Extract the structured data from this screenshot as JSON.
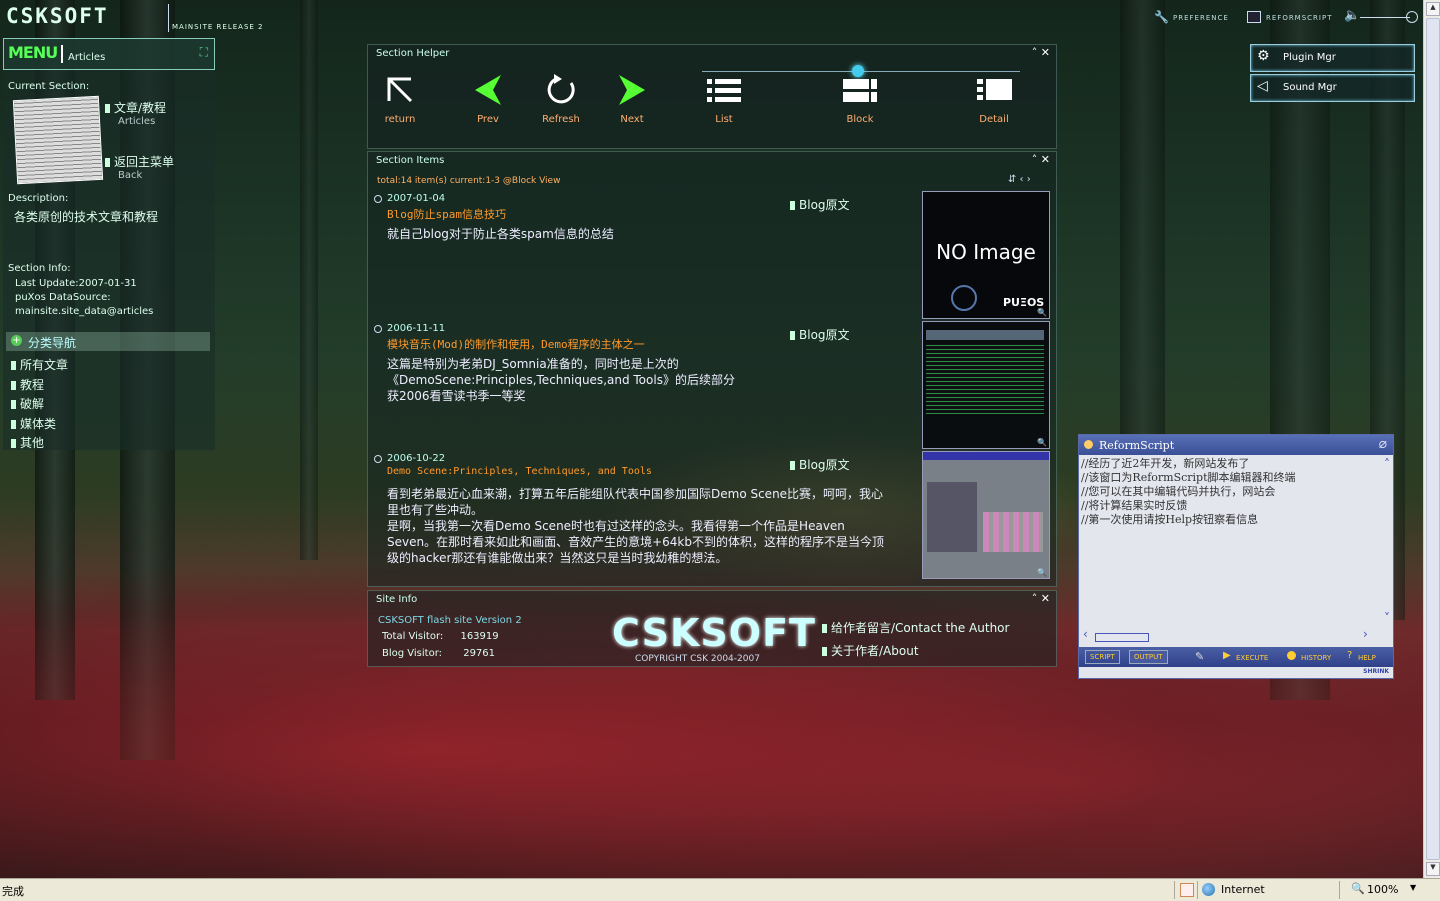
{
  "header": {
    "logo": "CSKSOFT",
    "release": "MAINSITE RELEASE 2",
    "preference": "PREFERENCE",
    "reformscript": "REFORMSCRIPT"
  },
  "left": {
    "menu_label": "MENU",
    "menu_section": "Articles",
    "current_section_label": "Current Section:",
    "links": [
      {
        "title": "文章/教程",
        "sub": "Articles"
      },
      {
        "title": "返回主菜单",
        "sub": "Back"
      }
    ],
    "description_label": "Description:",
    "description": "各类原创的技术文章和教程",
    "section_info_label": "Section Info:",
    "last_update": "Last Update:2007-01-31",
    "datasource_label": "puXos DataSource:",
    "datasource": "mainsite.site_data@articles",
    "category_header": "分类导航",
    "categories": [
      "所有文章",
      "教程",
      "破解",
      "媒体类",
      "其他"
    ]
  },
  "helper": {
    "title": "Section Helper",
    "buttons": [
      "return",
      "Prev",
      "Refresh",
      "Next",
      "List",
      "Block",
      "Detail"
    ]
  },
  "items": {
    "title": "Section Items",
    "status": "total:14 item(s) current:1-3 @Block View",
    "list": [
      {
        "date": "2007-01-04",
        "title": "Blog防止spam信息技巧",
        "tag": "Blog原文",
        "body": [
          "就自己blog对于防止各类spam信息的总结"
        ],
        "thumb": "noimage"
      },
      {
        "date": "2006-11-11",
        "title": "模块音乐(Mod)的制作和使用，Demo程序的主体之一",
        "tag": "Blog原文",
        "body": [
          "这篇是特别为老弟DJ_Somnia准备的，同时也是上次的",
          "《DemoScene:Principles,Techniques,and Tools》的后续部分",
          "获2006看雪读书季一等奖"
        ],
        "thumb": "screen1"
      },
      {
        "date": "2006-10-22",
        "title": "Demo Scene:Principles, Techniques, and Tools",
        "tag": "Blog原文",
        "body": [
          "看到老弟最近心血来潮，打算五年后能组队代表中国参加国际Demo Scene比赛，呵呵，我心",
          "里也有了些冲动。",
          "是啊，当我第一次看Demo Scene时也有过这样的念头。我看得第一个作品是Heaven",
          "Seven。在那时看来如此和画面、音效产生的意境+64kb不到的体积，这样的程序不是当今顶",
          "级的hacker那还有谁能做出来？当然这只是当时我幼稚的想法。"
        ],
        "thumb": "screen2"
      }
    ],
    "noimage_text": "NO Image",
    "noimage_brand": "PUΞOS"
  },
  "siteinfo": {
    "title": "Site Info",
    "version": "CSKSOFT flash site Version 2",
    "total_label": "Total Visitor:",
    "total": "163919",
    "blog_label": "Blog Visitor:",
    "blog": "29761",
    "logo": "CSKSOFT",
    "copyright": "COPYRIGHT CSK 2004-2007",
    "link_contact": "给作者留言/Contact the Author",
    "link_about": "关于作者/About"
  },
  "side_buttons": [
    "Plugin Mgr",
    "Sound Mgr"
  ],
  "reform": {
    "title": "ReformScript",
    "lines": [
      "//经历了近2年开发，新网站发布了",
      "//该窗口为ReformScript脚本编辑器和终端",
      "//您可以在其中编辑代码并执行，网站会",
      "//将计算结果实时反馈",
      "//第一次使用请按Help按钮察看信息"
    ],
    "tab_script": "SCRIPT",
    "tab_output": "OUTPUT",
    "execute": "EXECUTE",
    "history": "HISTORY",
    "help": "HELP",
    "shrink": "SHRINK"
  },
  "statusbar": {
    "left": "完成",
    "zone": "Internet",
    "zoom": "100%"
  }
}
